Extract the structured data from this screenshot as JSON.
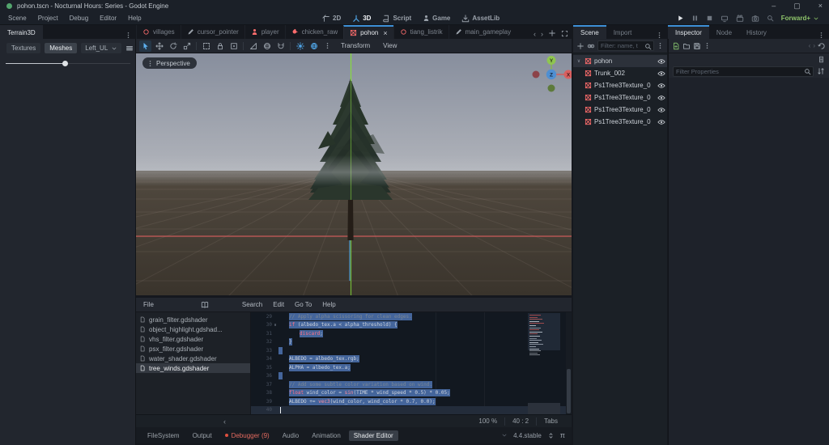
{
  "window": {
    "title": "pohon.tscn - Nocturnal Hours: Series - Godot Engine",
    "controls": {
      "minimize": "–",
      "maximize": "▢",
      "close": "×"
    }
  },
  "menubar": [
    "Scene",
    "Project",
    "Debug",
    "Editor",
    "Help"
  ],
  "workspaces": [
    {
      "label": "2D",
      "icon": "ws2d",
      "active": false
    },
    {
      "label": "3D",
      "icon": "ws3d",
      "active": true
    },
    {
      "label": "Script",
      "icon": "script",
      "active": false
    },
    {
      "label": "Game",
      "icon": "person-gray",
      "active": false
    },
    {
      "label": "AssetLib",
      "icon": "download",
      "active": false
    }
  ],
  "run_bar": {
    "renderer": "Forward+"
  },
  "scene_tabs": [
    {
      "label": "villages",
      "icon": "ring",
      "active": false
    },
    {
      "label": "cursor_pointer",
      "icon": "pencil",
      "active": false
    },
    {
      "label": "player",
      "icon": "person-red",
      "active": false
    },
    {
      "label": "chicken_raw",
      "icon": "bird",
      "active": false
    },
    {
      "label": "pohon",
      "icon": "meshbroken",
      "active": true
    },
    {
      "label": "tiang_listrik",
      "icon": "ring",
      "active": false
    },
    {
      "label": "main_gameplay",
      "icon": "pencil",
      "active": false
    }
  ],
  "left_dock": {
    "title": "Terrain3D",
    "buttons": [
      {
        "label": "Textures",
        "active": false
      },
      {
        "label": "Meshes",
        "active": true
      }
    ],
    "dropdown": "Left_UL",
    "slider_percent": 46
  },
  "viewport": {
    "projection": "Perspective",
    "menus": [
      "Transform",
      "View"
    ],
    "axes": {
      "x": "X",
      "y": "Y",
      "z": "Z"
    }
  },
  "scene_dock": {
    "tabs": [
      {
        "label": "Scene",
        "active": true
      },
      {
        "label": "Import",
        "active": false
      }
    ],
    "filter_placeholder": "Filter: name, t",
    "tree": [
      {
        "name": "pohon",
        "depth": 0,
        "expanded": true,
        "selected": true
      },
      {
        "name": "Trunk_002",
        "depth": 1
      },
      {
        "name": "Ps1Tree3Texture_0",
        "depth": 1
      },
      {
        "name": "Ps1Tree3Texture_0",
        "depth": 1
      },
      {
        "name": "Ps1Tree3Texture_0",
        "depth": 1
      },
      {
        "name": "Ps1Tree3Texture_0",
        "depth": 1
      }
    ]
  },
  "inspector_dock": {
    "tabs": [
      {
        "label": "Inspector",
        "active": true
      },
      {
        "label": "Node",
        "active": false
      },
      {
        "label": "History",
        "active": false
      }
    ],
    "filter_placeholder": "Filter Properties"
  },
  "shader_editor": {
    "menus": [
      "File",
      "Search",
      "Edit",
      "Go To",
      "Help"
    ],
    "files": [
      {
        "label": "grain_filter.gdshader",
        "selected": false
      },
      {
        "label": "object_highlight.gdshad...",
        "selected": false
      },
      {
        "label": "vhs_filter.gdshader",
        "selected": false
      },
      {
        "label": "psx_filter.gdshader",
        "selected": false
      },
      {
        "label": "water_shader.gdshader",
        "selected": false
      },
      {
        "label": "tree_winds.gdshader",
        "selected": true
      }
    ],
    "code": {
      "lines": [
        {
          "num": 29,
          "indent": 1,
          "selected": true,
          "tokens": [
            [
              "cmt",
              "// Apply alpha scissoring for clean edges."
            ]
          ]
        },
        {
          "num": 30,
          "indent": 1,
          "selected": true,
          "fold": true,
          "tokens": [
            [
              "kw",
              "if"
            ],
            [
              "pln",
              " (albedo_tex.a < alpha_threshold) {"
            ]
          ]
        },
        {
          "num": 31,
          "indent": 2,
          "selected": true,
          "tokens": [
            [
              "kw",
              "discard"
            ],
            [
              "pln",
              ";"
            ]
          ]
        },
        {
          "num": 32,
          "indent": 1,
          "selected": true,
          "tokens": [
            [
              "pln",
              "}"
            ]
          ]
        },
        {
          "num": 33,
          "indent": 0,
          "selected": true,
          "tokens": []
        },
        {
          "num": 34,
          "indent": 1,
          "selected": true,
          "tokens": [
            [
              "pln",
              "ALBEDO = albedo_tex.rgb;"
            ]
          ]
        },
        {
          "num": 35,
          "indent": 1,
          "selected": true,
          "tokens": [
            [
              "pln",
              "ALPHA = albedo_tex.a;"
            ]
          ]
        },
        {
          "num": 36,
          "indent": 0,
          "selected": true,
          "tokens": []
        },
        {
          "num": 37,
          "indent": 1,
          "selected": true,
          "tokens": [
            [
              "cmt",
              "// Add some subtle color variation based on wind."
            ]
          ]
        },
        {
          "num": 38,
          "indent": 1,
          "selected": true,
          "tokens": [
            [
              "kw",
              "float"
            ],
            [
              "pln",
              " wind_color = "
            ],
            [
              "fn",
              "sin"
            ],
            [
              "pln",
              "(TIME * wind_speed * 0.5) * 0.05;"
            ]
          ]
        },
        {
          "num": 39,
          "indent": 1,
          "selected": true,
          "tokens": [
            [
              "pln",
              "ALBEDO += "
            ],
            [
              "fn",
              "vec3"
            ],
            [
              "pln",
              "(wind_color, wind_color * 0.7, 0.0);"
            ]
          ]
        },
        {
          "num": 40,
          "indent": 0,
          "selected": false,
          "current": true,
          "tokens": []
        }
      ]
    },
    "status": {
      "zoom_level": "100 %",
      "cursor": "40 : 2",
      "indent_mode": "Tabs"
    }
  },
  "bottom_bar": {
    "tabs": [
      {
        "label": "FileSystem",
        "active": false
      },
      {
        "label": "Output",
        "active": false
      },
      {
        "label": "Debugger (9)",
        "alert": true,
        "active": false
      },
      {
        "label": "Audio",
        "active": false
      },
      {
        "label": "Animation",
        "active": false
      },
      {
        "label": "Shader Editor",
        "active": true
      }
    ],
    "version": "4.4.stable"
  },
  "colors": {
    "accent": "#3d8fd6",
    "selection": "#44659b",
    "keyword": "#ff7085",
    "node3d_icon": "#fc6c6c",
    "debugger_alert": "#e36a5f",
    "renderer_label": "#8ec46a",
    "axis_x": "#d95f5f",
    "axis_y": "#8fc550",
    "axis_z": "#4f8fd2"
  }
}
